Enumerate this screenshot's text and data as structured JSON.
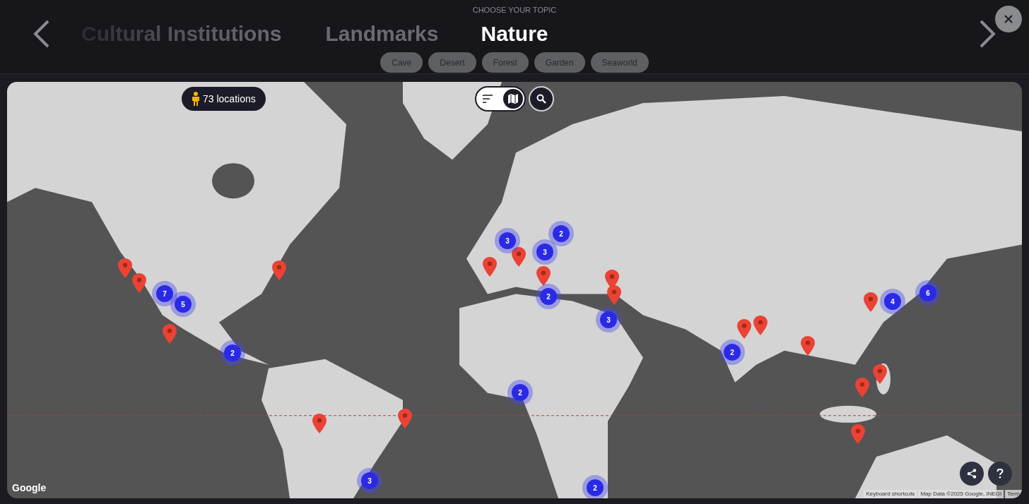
{
  "header": {
    "caption": "CHOOSE YOUR TOPIC",
    "topics": [
      {
        "label": "Cultural Institutions",
        "selected": false
      },
      {
        "label": "Landmarks",
        "selected": false
      },
      {
        "label": "Nature",
        "selected": true
      }
    ],
    "chips": [
      "Cave",
      "Desert",
      "Forest",
      "Garden",
      "Seaworld"
    ]
  },
  "map": {
    "locations": "73 locations",
    "view_toggle": [
      {
        "kind": "list",
        "selected": false
      },
      {
        "kind": "map",
        "selected": true
      }
    ],
    "markers": [
      {
        "kind": "pin"
      },
      {
        "kind": "pin"
      },
      {
        "kind": "pin"
      },
      {
        "kind": "pin"
      },
      {
        "kind": "pin"
      },
      {
        "kind": "pin"
      },
      {
        "kind": "pin"
      },
      {
        "kind": "pin"
      },
      {
        "kind": "pin"
      },
      {
        "kind": "pin"
      },
      {
        "kind": "pin"
      },
      {
        "kind": "pin"
      },
      {
        "kind": "pin"
      },
      {
        "kind": "pin"
      },
      {
        "kind": "pin"
      },
      {
        "kind": "pin"
      },
      {
        "kind": "pin"
      },
      {
        "kind": "pin"
      },
      {
        "kind": "cluster",
        "count": "3"
      },
      {
        "kind": "cluster",
        "count": "2"
      },
      {
        "kind": "cluster",
        "count": "3"
      },
      {
        "kind": "cluster",
        "count": "7"
      },
      {
        "kind": "cluster",
        "count": "5"
      },
      {
        "kind": "cluster",
        "count": "2"
      },
      {
        "kind": "cluster",
        "count": "3"
      },
      {
        "kind": "cluster",
        "count": "2"
      },
      {
        "kind": "cluster",
        "count": "2"
      },
      {
        "kind": "cluster",
        "count": "2"
      },
      {
        "kind": "cluster",
        "count": "3"
      },
      {
        "kind": "cluster",
        "count": "2"
      },
      {
        "kind": "cluster",
        "count": "4"
      },
      {
        "kind": "cluster",
        "count": "6"
      }
    ],
    "logo": "Google",
    "attribution": [
      "Keyboard shortcuts",
      "Map Data ©2025 Google, INEGI",
      "Term"
    ]
  }
}
